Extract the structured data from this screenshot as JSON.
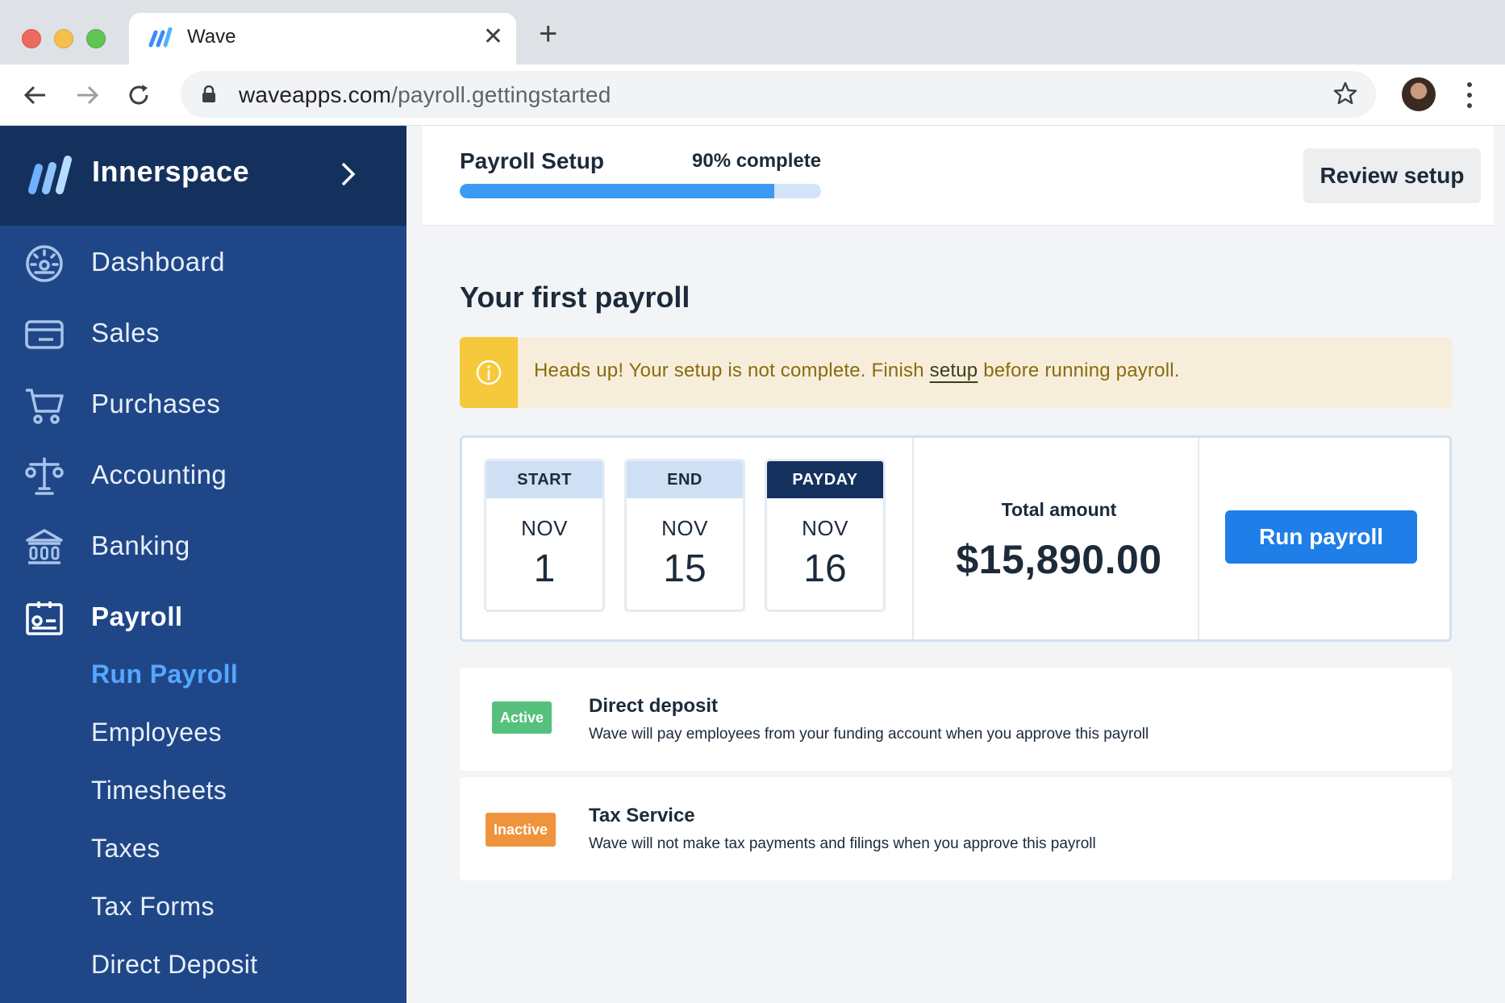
{
  "browser": {
    "tab_title": "Wave",
    "url_domain": "waveapps.com",
    "url_path": "/payroll.gettingstarted"
  },
  "sidebar": {
    "business_name": "Innerspace",
    "items": [
      {
        "label": "Dashboard",
        "icon": "dashboard-icon"
      },
      {
        "label": "Sales",
        "icon": "card-icon"
      },
      {
        "label": "Purchases",
        "icon": "cart-icon"
      },
      {
        "label": "Accounting",
        "icon": "scale-icon"
      },
      {
        "label": "Banking",
        "icon": "bank-icon"
      },
      {
        "label": "Payroll",
        "icon": "id-card-icon"
      }
    ],
    "payroll_subitems": [
      "Run Payroll",
      "Employees",
      "Timesheets",
      "Taxes",
      "Tax Forms",
      "Direct Deposit"
    ]
  },
  "setup": {
    "title": "Payroll Setup",
    "percent_label": "90% complete",
    "progress": 0.87,
    "review_button": "Review setup"
  },
  "payroll": {
    "section_title": "Your first payroll",
    "alert_text_before": "Heads up! Your setup is not complete. Finish ",
    "alert_link": "setup",
    "alert_text_after": " before running payroll.",
    "dates": [
      {
        "label": "START",
        "month": "NOV",
        "day": "1"
      },
      {
        "label": "END",
        "month": "NOV",
        "day": "15"
      },
      {
        "label": "PAYDAY",
        "month": "NOV",
        "day": "16"
      }
    ],
    "total_label": "Total amount",
    "total_value": "$15,890.00",
    "run_button": "Run payroll"
  },
  "services": [
    {
      "status": "Active",
      "title": "Direct deposit",
      "description": "Wave will pay employees from your funding account when you approve this payroll"
    },
    {
      "status": "Inactive",
      "title": "Tax Service",
      "description": "Wave will not make tax payments and filings when you approve this payroll"
    }
  ],
  "colors": {
    "sidebar_bg": "#1f4788",
    "brand_bg": "#14315e",
    "accent": "#1f7ee8",
    "active_sub": "#56a6ff",
    "alert_bg": "#f6eedb",
    "alert_bar": "#f5c93b",
    "active_badge": "#56c17d",
    "inactive_badge": "#f0933d"
  }
}
